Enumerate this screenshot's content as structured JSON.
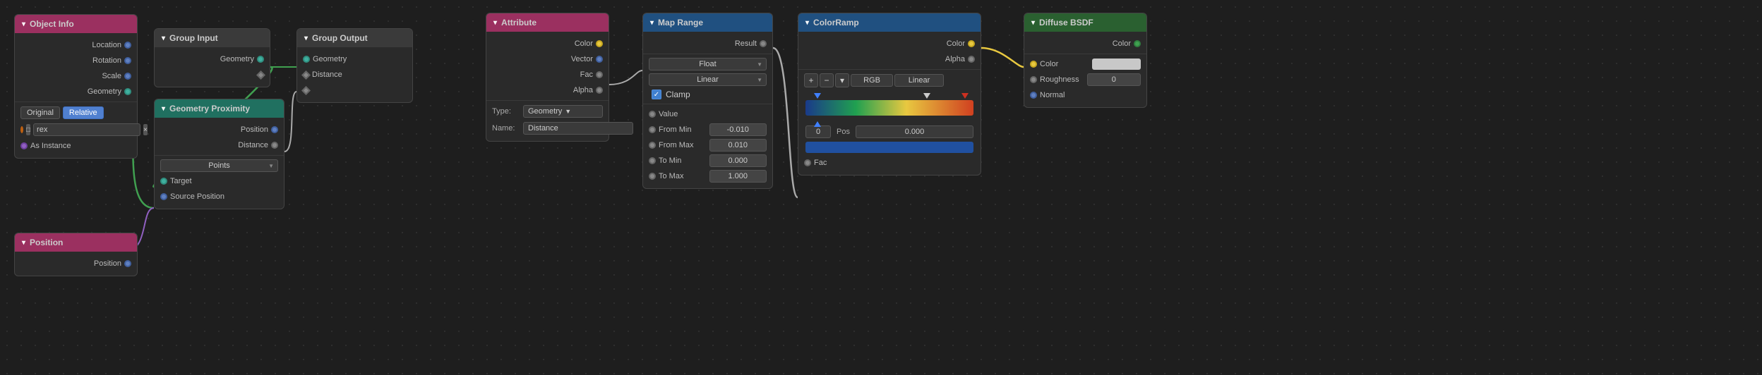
{
  "nodes": {
    "object_info": {
      "title": "Object Info",
      "outputs": [
        "Location",
        "Rotation",
        "Scale",
        "Geometry"
      ],
      "buttons": [
        "Original",
        "Relative"
      ],
      "active_button": "Relative",
      "object_name": "rex",
      "instance_label": "As Instance"
    },
    "position": {
      "title": "Position",
      "outputs": [
        "Position"
      ]
    },
    "group_input": {
      "title": "Group Input",
      "outputs": [
        "Geometry"
      ]
    },
    "group_output": {
      "title": "Group Output",
      "inputs": [
        "Geometry",
        "Distance"
      ]
    },
    "geo_proximity": {
      "title": "Geometry Proximity",
      "dropdown": "Points",
      "outputs": [
        "Position",
        "Distance"
      ],
      "inputs": [
        "Target",
        "Source Position"
      ]
    },
    "attribute": {
      "title": "Attribute",
      "outputs": [
        "Color",
        "Vector",
        "Fac",
        "Alpha"
      ],
      "type_label": "Type:",
      "type_value": "Geometry",
      "name_label": "Name:",
      "name_value": "Distance"
    },
    "map_range": {
      "title": "Map Range",
      "inputs": [
        "Result"
      ],
      "dropdown1": "Float",
      "dropdown2": "Linear",
      "clamp_label": "Clamp",
      "value_label": "Value",
      "from_min_label": "From Min",
      "from_min_value": "-0.010",
      "from_max_label": "From Max",
      "from_max_value": "0.010",
      "to_min_label": "To Min",
      "to_min_value": "0.000",
      "to_max_label": "To Max",
      "to_max_value": "1.000",
      "outputs": [
        "Result"
      ]
    },
    "color_ramp": {
      "title": "ColorRamp",
      "outputs": [
        "Color",
        "Alpha"
      ],
      "inputs": [
        "Fac"
      ],
      "add_btn": "+",
      "remove_btn": "−",
      "interpolation_btn": "▾",
      "color_mode": "RGB",
      "interp_mode": "Linear",
      "pos_zero": "0",
      "pos_label": "Pos",
      "pos_value": "0.000"
    },
    "diffuse_bsdf": {
      "title": "Diffuse BSDF",
      "outputs": [
        "Color"
      ],
      "inputs": [
        "Color",
        "Roughness",
        "Normal"
      ],
      "roughness_value": "0"
    }
  }
}
